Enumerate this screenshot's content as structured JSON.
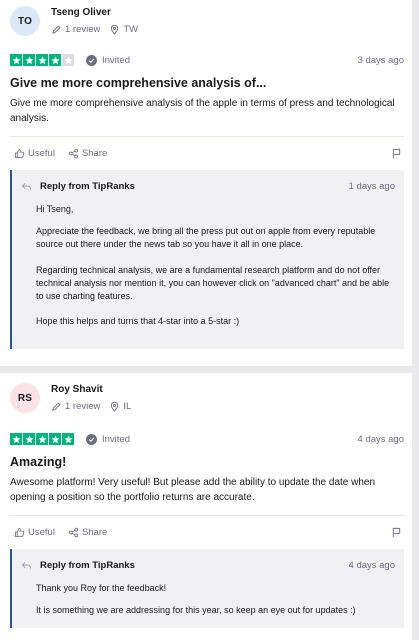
{
  "reviews": [
    {
      "initials": "TO",
      "name": "Tseng Oliver",
      "review_count": "1 review",
      "country": "TW",
      "rating": 4,
      "invited_label": "Invited",
      "date": "3 days ago",
      "title": "Give me more comprehensive analysis of...",
      "body": "Give me more comprehensive analysis of the apple in terms of press and technological analysis.",
      "useful_label": "Useful",
      "share_label": "Share",
      "reply": {
        "title": "Reply from TipRanks",
        "date": "1 days ago",
        "paragraphs": [
          "Hi Tseng,",
          "Appreciate the feedback, we bring all the press put out on apple from every reputable source out there under the news tab so you have it all in one place.",
          "Regarding technical analysis, we are a fundamental research platform and do not offer technical analysis nor mention it, you can however click on \"advanced chart\" and be able to use charting features.",
          "Hope this helps and turns that 4-star into a 5-star :)"
        ]
      }
    },
    {
      "initials": "RS",
      "name": "Roy Shavit",
      "review_count": "1 review",
      "country": "IL",
      "rating": 5,
      "invited_label": "Invited",
      "date": "4 days ago",
      "title": "Amazing!",
      "body": "Awesome platform! Very useful! But please add the ability to update the date when opening a position so the portfolio returns are accurate.",
      "useful_label": "Useful",
      "share_label": "Share",
      "reply": {
        "title": "Reply from TipRanks",
        "date": "4 days ago",
        "paragraphs": [
          "Thank you Roy for the feedback!",
          "It is something we are addressing for this year, so keep an eye out for updates :)"
        ]
      }
    }
  ],
  "colors": {
    "star_on": "#00b67a",
    "star_off": "#dcdce6",
    "reply_accent": "#2458a6",
    "muted_text": "#6c6c85"
  },
  "icons": [
    "pencil-icon",
    "location-pin-icon",
    "check-circle-icon",
    "star-icon",
    "thumbs-up-icon",
    "share-icon",
    "flag-icon",
    "reply-arrow-icon"
  ]
}
